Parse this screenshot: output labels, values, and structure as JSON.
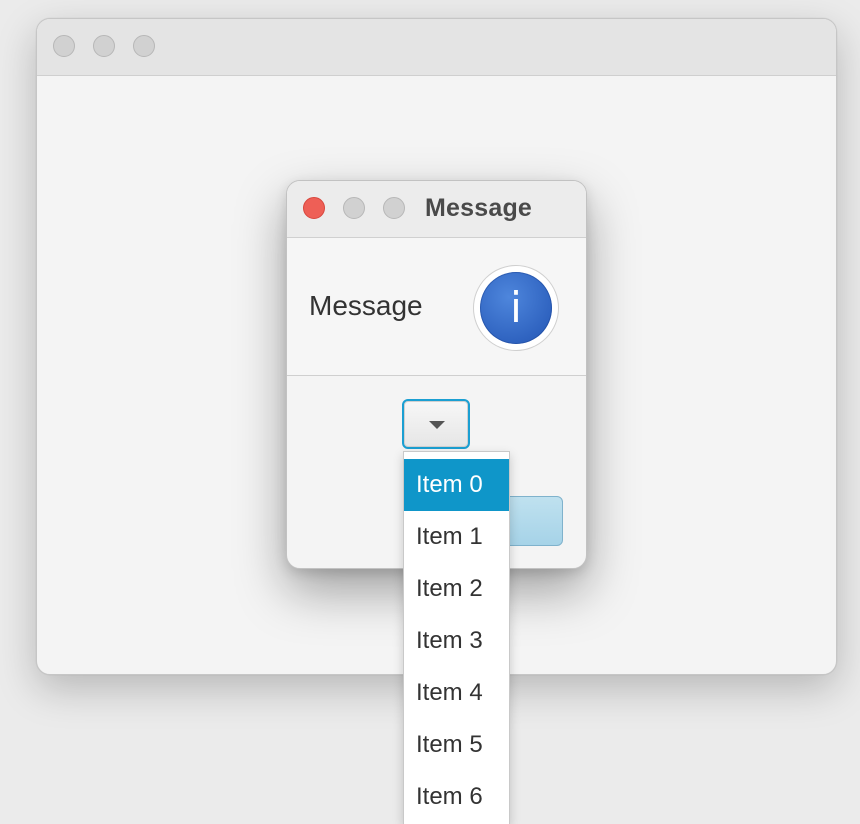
{
  "main_window": {
    "title": ""
  },
  "dialog": {
    "title": "Message",
    "header_text": "Message",
    "info_glyph": "i",
    "icon": "info-icon",
    "combo": {
      "icon": "chevron-down-icon",
      "selected_value": ""
    }
  },
  "dropdown": {
    "selected_index": 0,
    "items": [
      "Item 0",
      "Item 1",
      "Item 2",
      "Item 3",
      "Item 4",
      "Item 5",
      "Item 6"
    ]
  },
  "colors": {
    "close_button": "#ee5f56",
    "accent": "#0f96c9",
    "info_icon": "#2f63c0"
  }
}
